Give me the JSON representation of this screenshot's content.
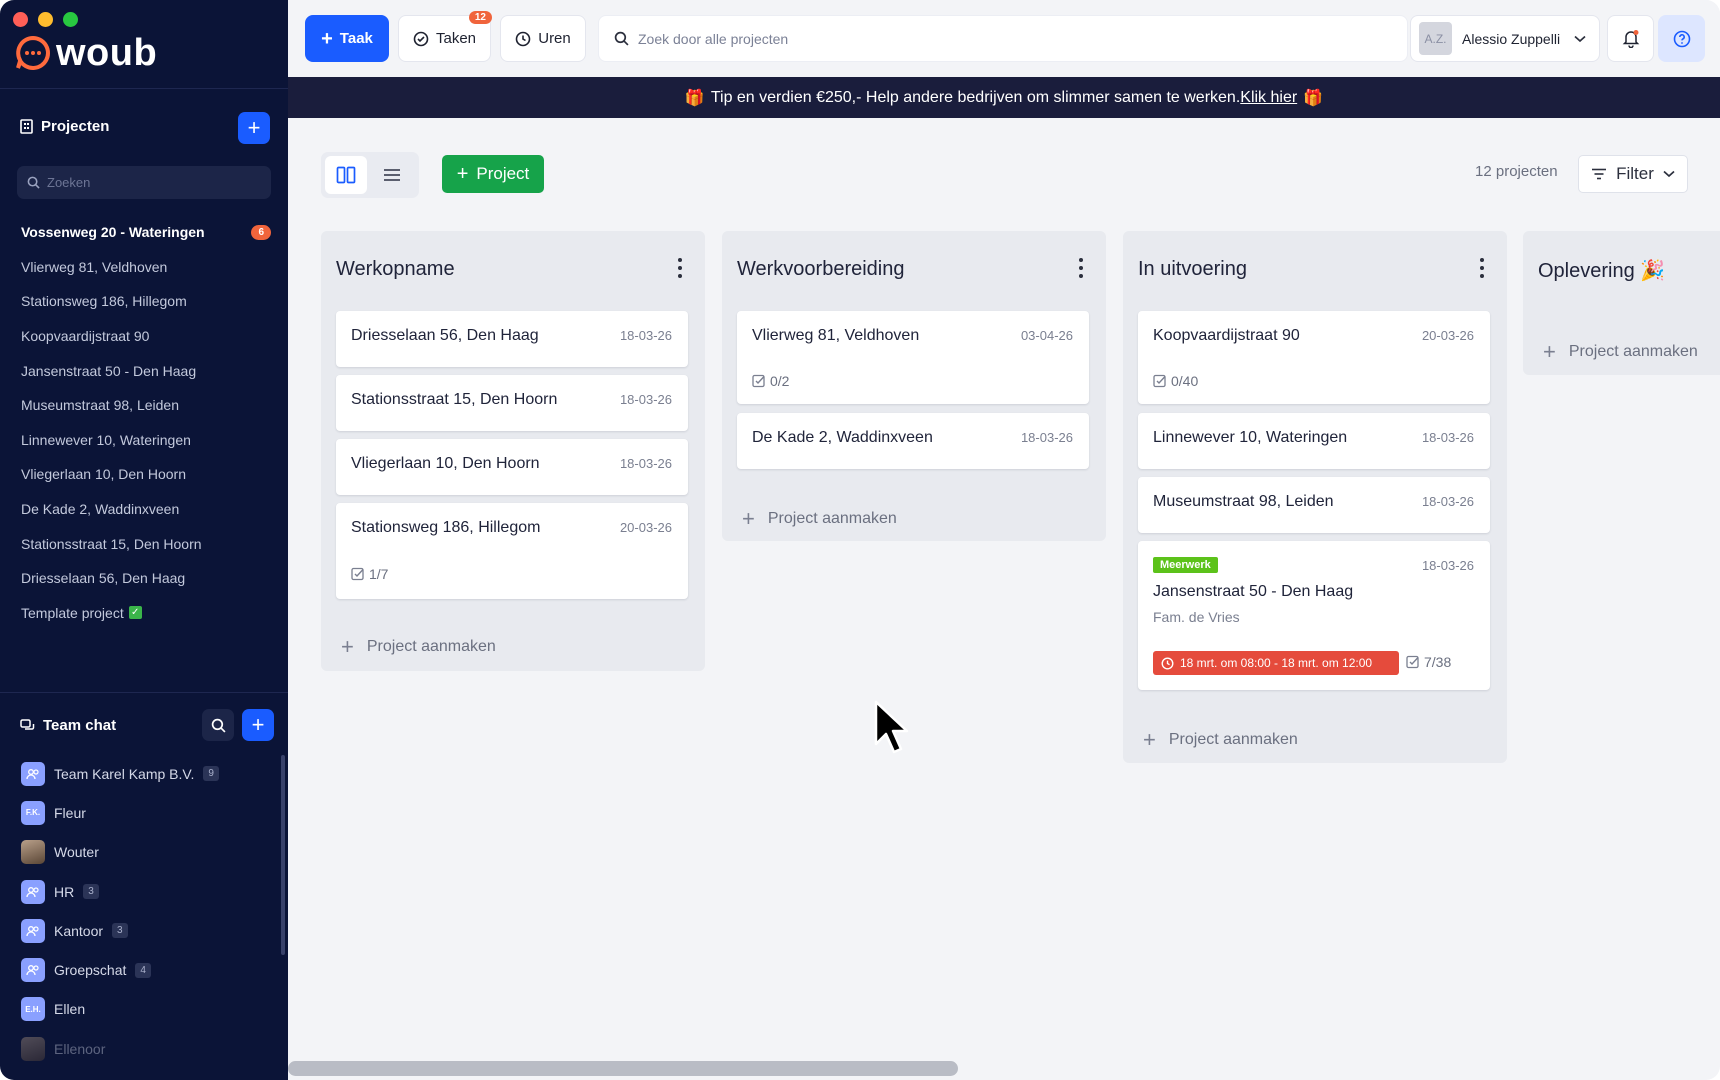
{
  "app": {
    "logo_text": "woub",
    "traffic_colors": [
      "#ff5f57",
      "#febc2e",
      "#28c840"
    ]
  },
  "topbar": {
    "task_button": "Taak",
    "tasks_button": "Taken",
    "tasks_badge": "12",
    "hours_button": "Uren",
    "search_placeholder": "Zoek door alle projecten",
    "user_initials": "A.Z.",
    "user_name": "Alessio Zuppelli"
  },
  "banner": {
    "text": "Tip en verdien €250,- Help andere bedrijven om slimmer samen te werken.",
    "link": "Klik hier",
    "icon_left": "🎁",
    "icon_right": "🎁"
  },
  "sidebar": {
    "projects_title": "Projecten",
    "search_placeholder": "Zoeken",
    "projects": [
      {
        "label": "Vossenweg 20 - Wateringen",
        "badge": "6",
        "active": true
      },
      {
        "label": "Vlierweg 81, Veldhoven"
      },
      {
        "label": "Stationsweg 186, Hillegom"
      },
      {
        "label": "Koopvaardijstraat 90"
      },
      {
        "label": "Jansenstraat 50 - Den Haag"
      },
      {
        "label": "Museumstraat 98, Leiden"
      },
      {
        "label": "Linnewever 10, Wateringen"
      },
      {
        "label": "Vliegerlaan 10, Den Hoorn"
      },
      {
        "label": "De Kade 2, Waddinxveen"
      },
      {
        "label": "Stationsstraat 15, Den Hoorn"
      },
      {
        "label": "Driesselaan 56, Den Haag"
      },
      {
        "label": "Template project",
        "check": "✓"
      }
    ],
    "chat_title": "Team chat",
    "chats": [
      {
        "name": "Team Karel Kamp B.V.",
        "count": "9",
        "avatar": "group-icon"
      },
      {
        "name": "Fleur",
        "initials": "F.K."
      },
      {
        "name": "Wouter",
        "avatar": "photo"
      },
      {
        "name": "HR",
        "count": "3",
        "avatar": "group-icon"
      },
      {
        "name": "Kantoor",
        "count": "3",
        "avatar": "group-icon"
      },
      {
        "name": "Groepschat",
        "count": "4",
        "avatar": "group-icon"
      },
      {
        "name": "Ellen",
        "initials": "E.H."
      },
      {
        "name": "Ellenoor",
        "avatar": "photo"
      }
    ]
  },
  "board": {
    "new_project_button": "Project",
    "project_count": "12 projecten",
    "filter_label": "Filter",
    "add_project_label": "Project aanmaken",
    "columns": [
      {
        "title": "Werkopname",
        "cards": [
          {
            "title": "Driesselaan 56, Den Haag",
            "date": "18-03-26"
          },
          {
            "title": "Stationsstraat 15, Den Hoorn",
            "date": "18-03-26"
          },
          {
            "title": "Vliegerlaan 10, Den Hoorn",
            "date": "18-03-26"
          },
          {
            "title": "Stationsweg 186, Hillegom",
            "date": "20-03-26",
            "tasks": "1/7"
          }
        ]
      },
      {
        "title": "Werkvoorbereiding",
        "cards": [
          {
            "title": "Vlierweg 81, Veldhoven",
            "date": "03-04-26",
            "tasks": "0/2"
          },
          {
            "title": "De Kade 2, Waddinxveen",
            "date": "18-03-26"
          }
        ]
      },
      {
        "title": "In uitvoering",
        "cards": [
          {
            "title": "Koopvaardijstraat 90",
            "date": "20-03-26",
            "tasks": "0/40"
          },
          {
            "title": "Linnewever 10, Wateringen",
            "date": "18-03-26"
          },
          {
            "title": "Museumstraat 98, Leiden",
            "date": "18-03-26"
          },
          {
            "title": "Jansenstraat 50 - Den Haag",
            "date": "18-03-26",
            "tag": "Meerwerk",
            "subtitle": "Fam. de Vries",
            "time": "18 mrt. om 08:00 - 18 mrt. om 12:00",
            "tasks": "7/38"
          }
        ]
      },
      {
        "title": "Oplevering 🎉",
        "cards": []
      }
    ]
  },
  "colors": {
    "sidebar_bg": "#0b1437",
    "primary_blue": "#1a5cff",
    "green": "#16a34a",
    "orange_badge": "#f0643c",
    "banner_bg": "#1a1d3c",
    "tag_green": "#5cc21a",
    "time_red": "#e54b3c"
  }
}
